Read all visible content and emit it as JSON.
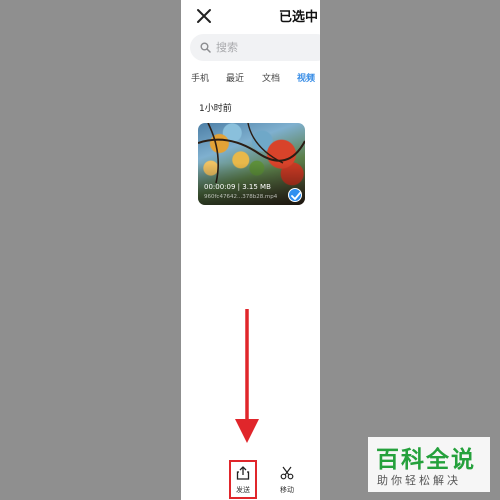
{
  "header": {
    "title": "已选中"
  },
  "search": {
    "placeholder": "搜索"
  },
  "tabs": [
    {
      "label": "手机"
    },
    {
      "label": "最近"
    },
    {
      "label": "文档"
    },
    {
      "label": "视频",
      "active": true
    }
  ],
  "section": {
    "label": "1小时前"
  },
  "video": {
    "meta": "00:00:09 | 3.15 MB",
    "filename": "960fc47642...378b28.mp4",
    "selected": true
  },
  "bottom_bar": {
    "send_label": "发送",
    "move_label": "移动"
  },
  "watermark": {
    "title": "百科全说",
    "subtitle": "助你轻松解决"
  },
  "colors": {
    "accent": "#3a8ee6",
    "check": "#2f8ff0",
    "annotation": "#e0262b",
    "watermark": "#25a13c"
  }
}
